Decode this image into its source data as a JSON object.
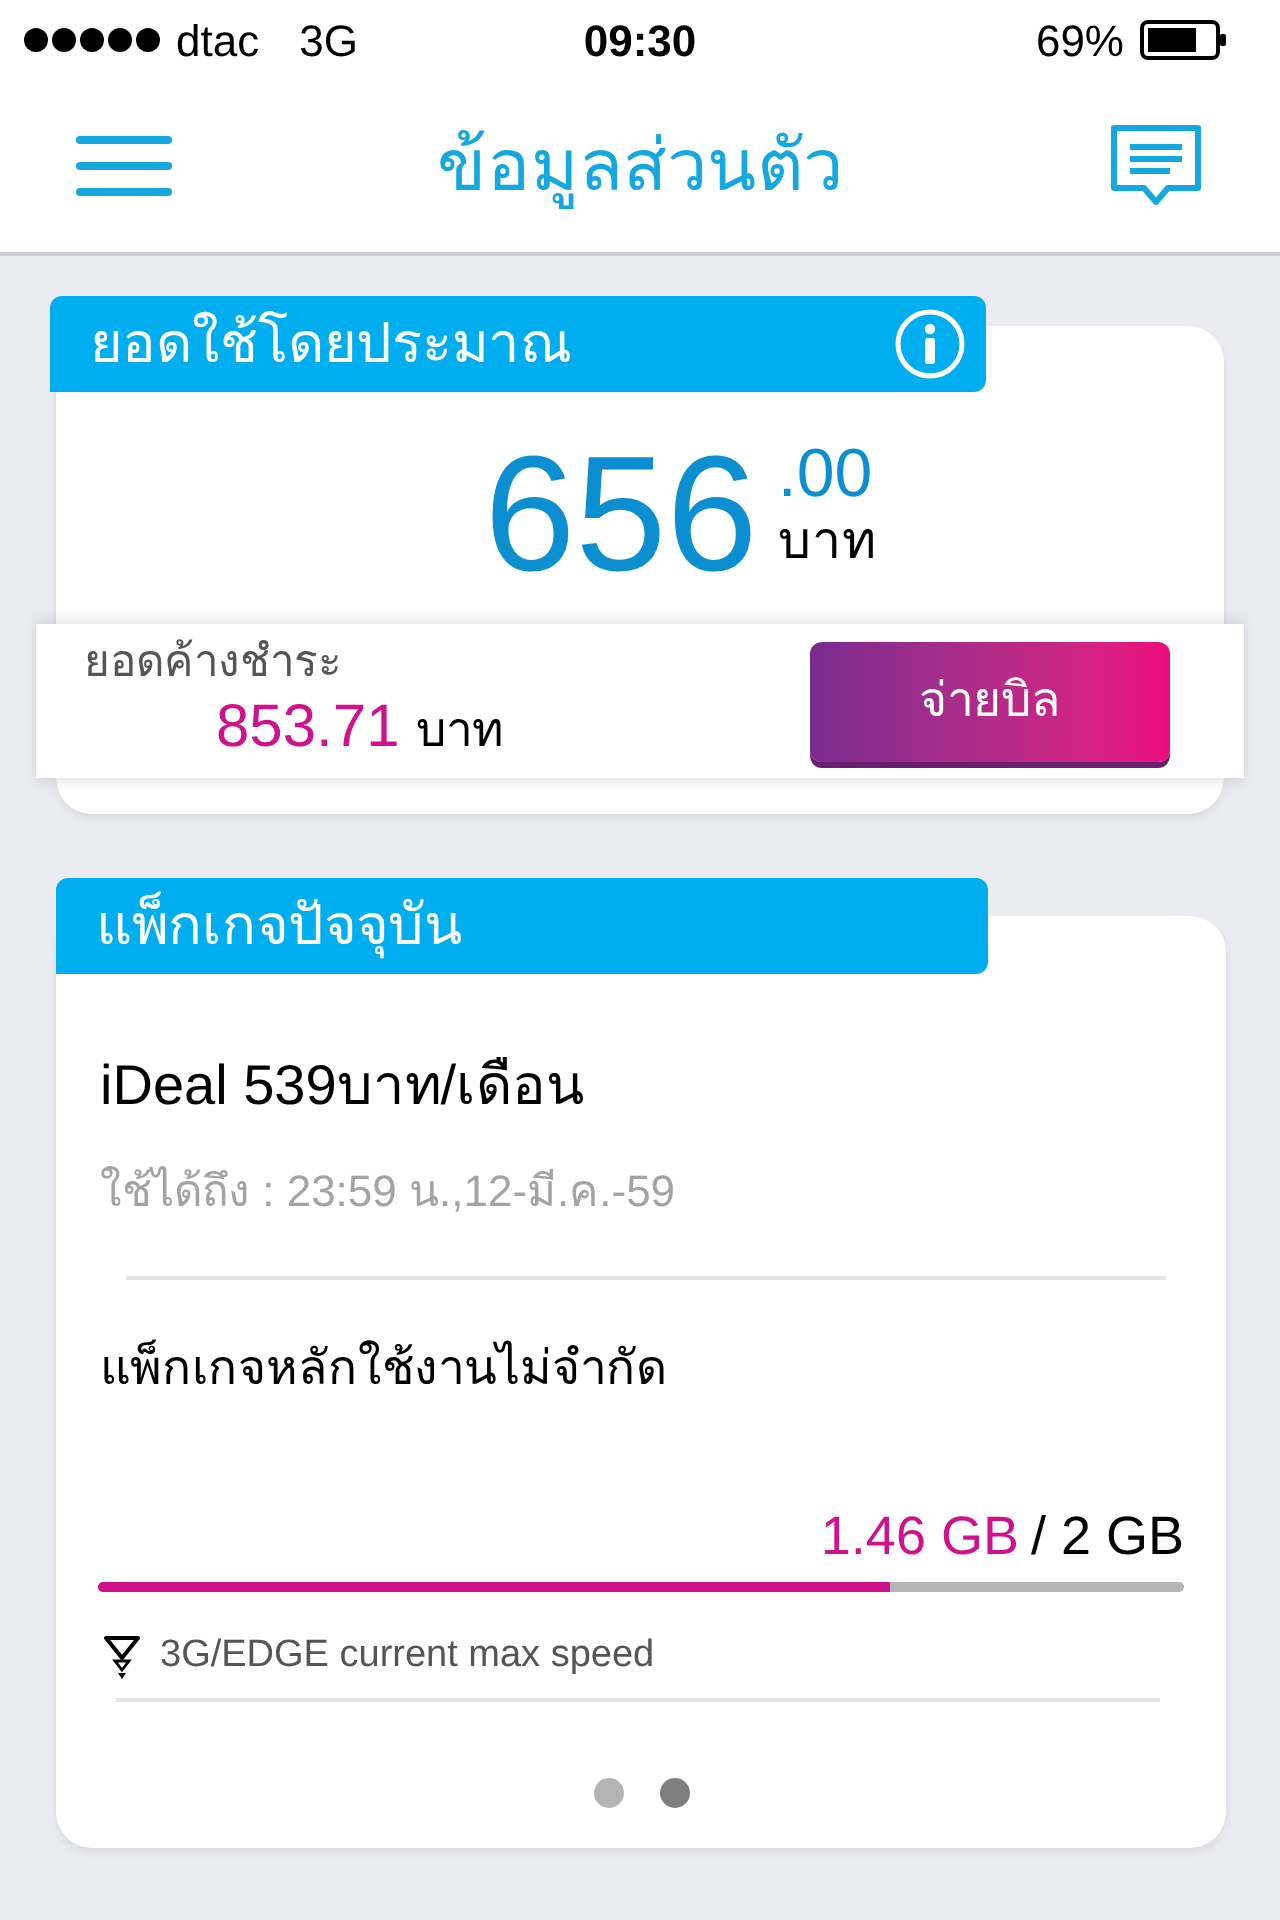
{
  "status_bar": {
    "carrier": "dtac",
    "network": "3G",
    "time": "09:30",
    "battery": "69%"
  },
  "nav": {
    "title": "ข้อมูลส่วนตัว"
  },
  "usage_card": {
    "header": "ยอดใช้โดยประมาณ",
    "amount": "656",
    "decimals": ".00",
    "currency": "บาท",
    "outstanding": {
      "label": "ยอดค้างชำระ",
      "amount": "853.71",
      "currency": "บาท"
    },
    "pay_button": "จ่ายบิล"
  },
  "package_card": {
    "header": "แพ็กเกจปัจจุบัน",
    "plan": "iDeal 539บาท/เดือน",
    "valid_until": "ใช้ได้ถึง : 23:59 น.,12-มี.ค.-59",
    "quota": {
      "name": "แพ็กเกจหลักใช้งานไม่จำกัด",
      "used": "1.46 GB",
      "total": "/ 2 GB",
      "level": 0.73,
      "note": "3G/EDGE current max speed"
    },
    "pages": [
      {
        "selected": false
      },
      {
        "selected": true
      }
    ]
  }
}
